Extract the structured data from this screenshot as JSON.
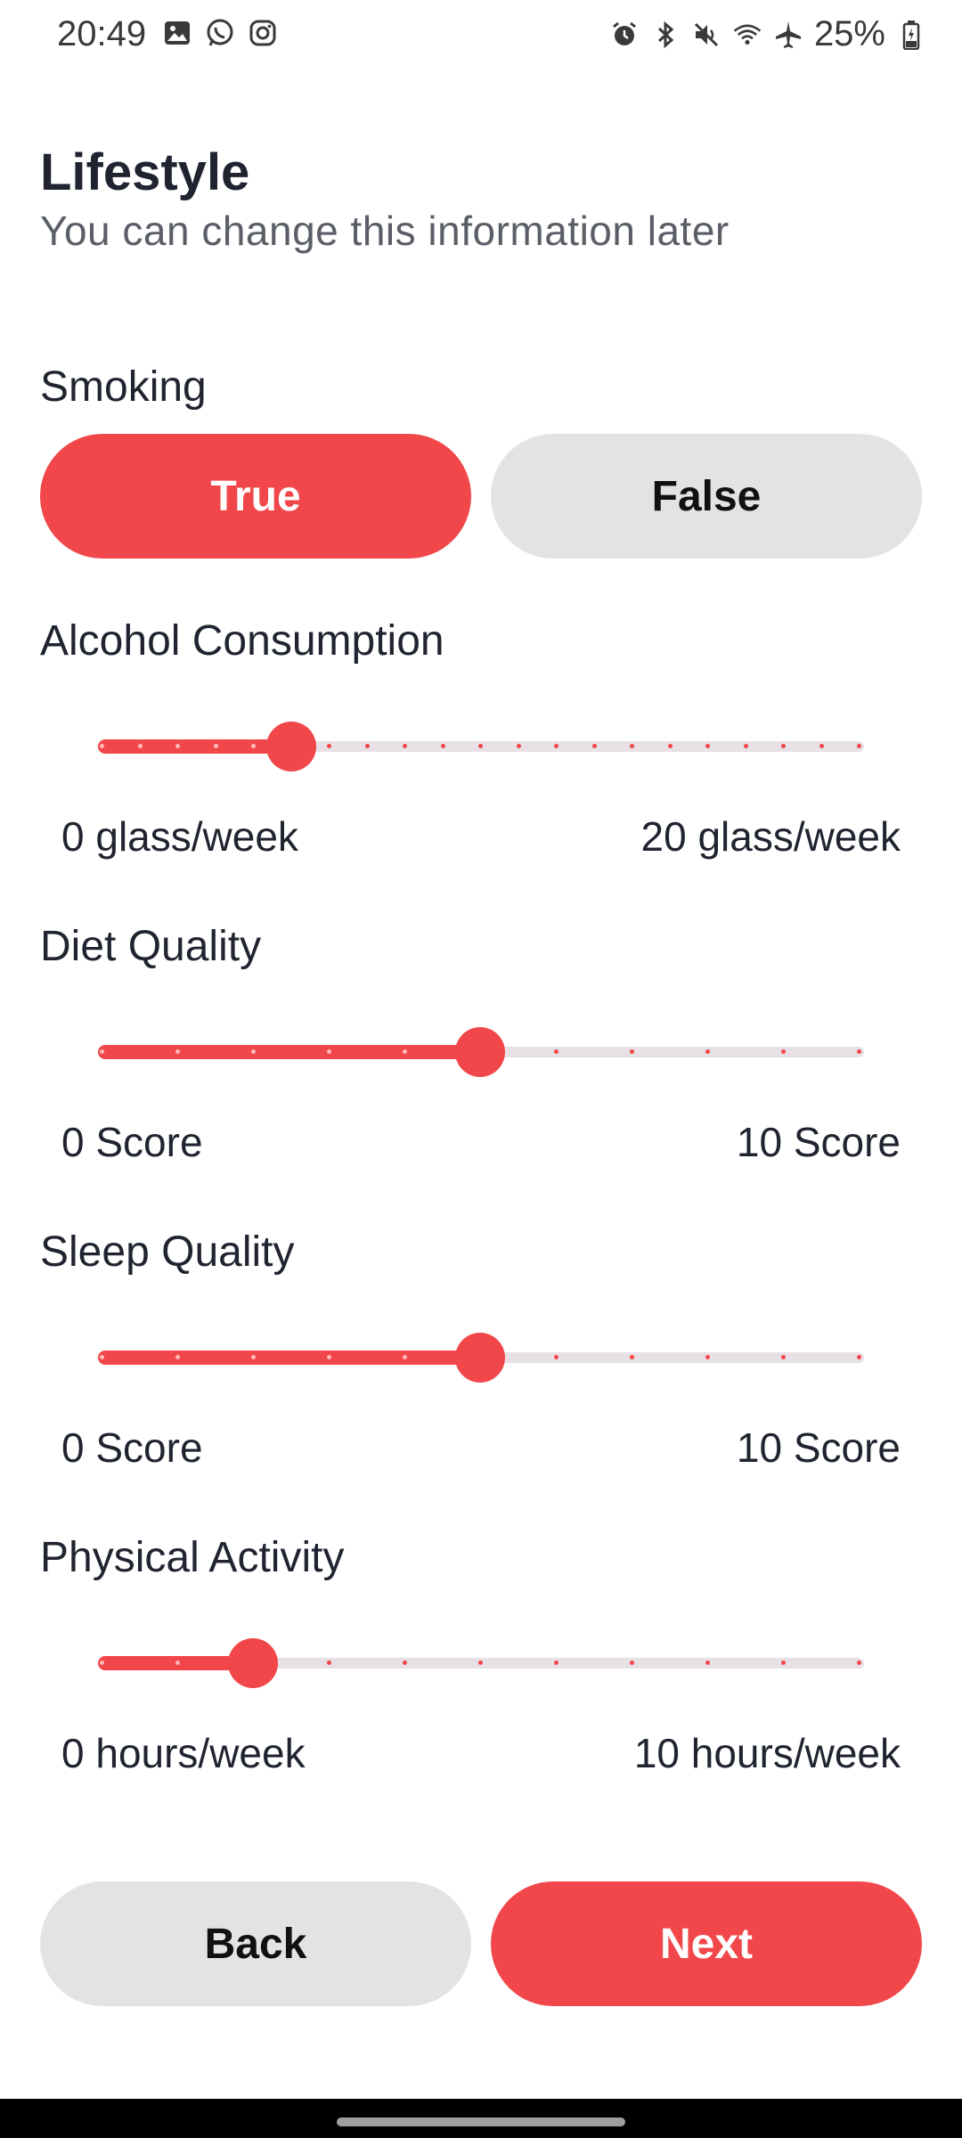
{
  "status_bar": {
    "time": "20:49",
    "battery_text": "25%",
    "left_icons": [
      "gallery-icon",
      "whatsapp-icon",
      "instagram-icon"
    ],
    "right_icons": [
      "alarm-icon",
      "bluetooth-icon",
      "mute-icon",
      "wifi-icon",
      "airplane-icon",
      "battery-icon"
    ]
  },
  "header": {
    "title": "Lifestyle",
    "subtitle": "You can change this information later"
  },
  "smoking": {
    "label": "Smoking",
    "true_label": "True",
    "false_label": "False",
    "selected": "True"
  },
  "sliders": [
    {
      "label": "Alcohol Consumption",
      "min_label": "0 glass/week",
      "max_label": "20 glass/week",
      "min": 0,
      "max": 20,
      "value": 5
    },
    {
      "label": "Diet Quality",
      "min_label": "0 Score",
      "max_label": "10 Score",
      "min": 0,
      "max": 10,
      "value": 5
    },
    {
      "label": "Sleep Quality",
      "min_label": "0 Score",
      "max_label": "10 Score",
      "min": 0,
      "max": 10,
      "value": 5
    },
    {
      "label": "Physical Activity",
      "min_label": "0 hours/week",
      "max_label": "10 hours/week",
      "min": 0,
      "max": 10,
      "value": 2
    }
  ],
  "actions": {
    "back_label": "Back",
    "next_label": "Next"
  },
  "colors": {
    "accent": "#f1474a",
    "button_grey": "#e3e3e3",
    "track": "#e7e1e6"
  }
}
